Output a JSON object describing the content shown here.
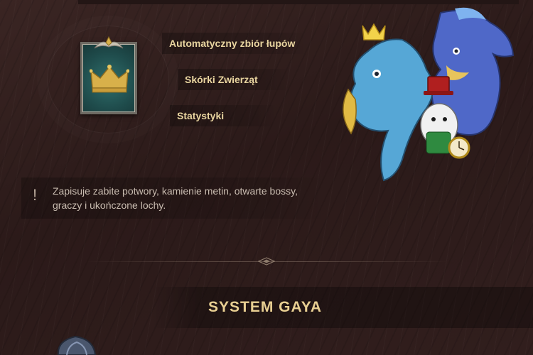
{
  "menu": {
    "items": [
      {
        "label": "Automatyczny zbiór łupów"
      },
      {
        "label": "Skórki Zwierząt"
      },
      {
        "label": "Statystyki"
      }
    ]
  },
  "info": {
    "icon": "exclamation-icon",
    "text": "Zapisuje zabite potwory, kamienie metin, otwarte bossy, graczy i ukończone lochy.",
    "mark": "!"
  },
  "section": {
    "title": "SYSTEM GAYA"
  },
  "colors": {
    "background": "#2f1e1d",
    "menu_text": "#e9d5a0",
    "title_text": "#e8cf92",
    "info_text": "#c9bcb0",
    "emblem_teal": "#2f6f6c",
    "crown_gold": "#d8b04a"
  }
}
